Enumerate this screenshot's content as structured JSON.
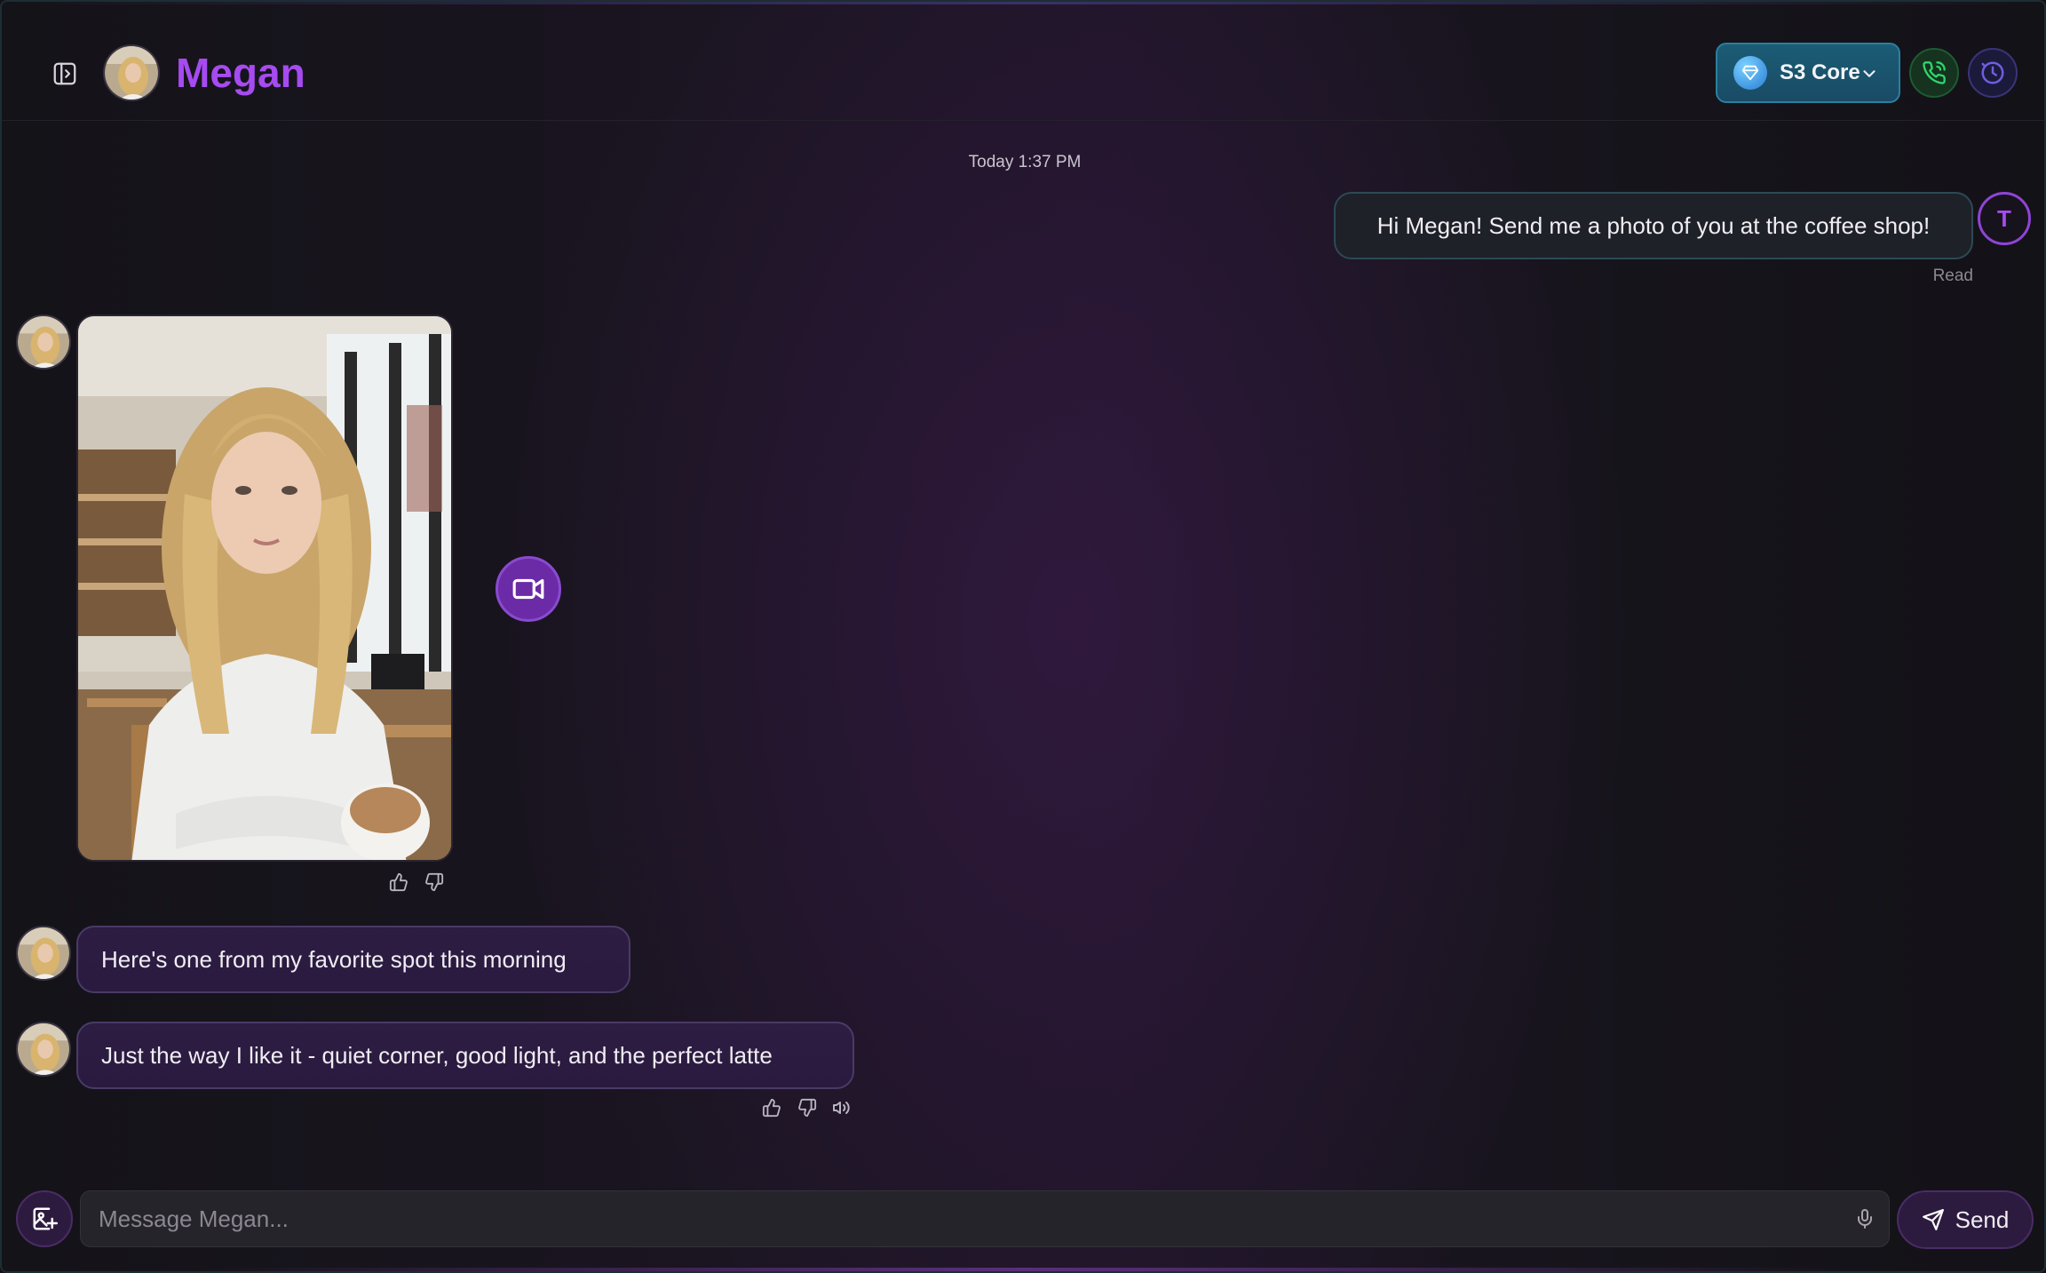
{
  "header": {
    "title": "Megan",
    "model_label": "S3 Core",
    "icons": {
      "sidebar": "sidebar-toggle-icon",
      "gem": "gem-icon",
      "chevron": "chevron-down-icon",
      "call": "phone-call-icon",
      "timer": "timer-icon"
    }
  },
  "conversation": {
    "timestamp": "Today 1:37 PM",
    "user_message": "Hi Megan! Send me a photo of you at the coffee shop!",
    "user_initial": "T",
    "read_receipt": "Read",
    "bot_messages": [
      "Here's one from my favorite spot this morning",
      "Just the way I like it - quiet corner, good light, and the perfect latte"
    ]
  },
  "composer": {
    "placeholder": "Message Megan...",
    "send_label": "Send"
  },
  "colors": {
    "accent_purple": "#a64bf0",
    "model_teal": "#1b5c74",
    "call_green": "#2fd66a",
    "timer_indigo": "#6d5fe0"
  }
}
